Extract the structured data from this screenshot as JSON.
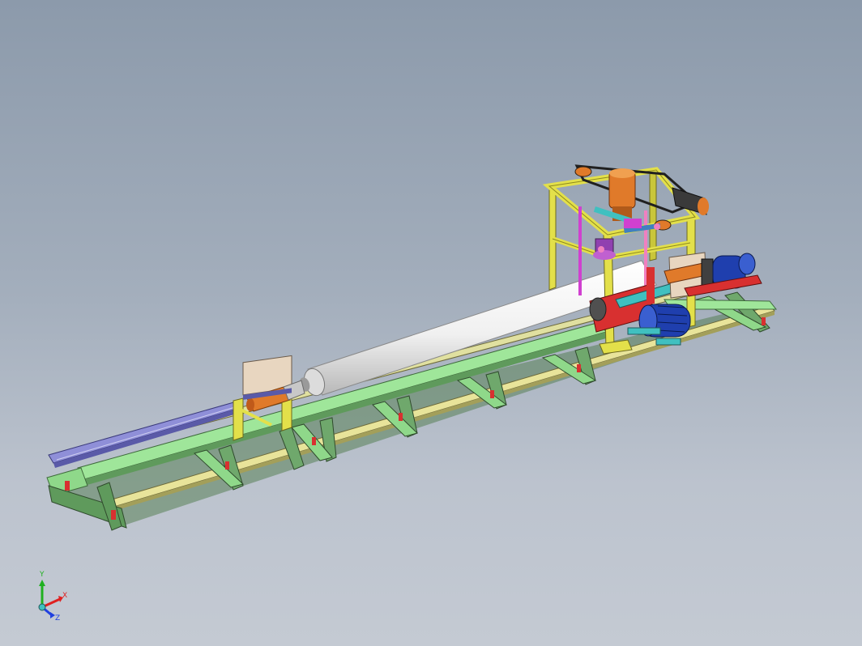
{
  "viewport": {
    "background_top": "#8c9aab",
    "background_bottom": "#c4cad3"
  },
  "model": {
    "colors": {
      "frame_green": "#9fe69a",
      "frame_green_dark": "#5f9a5c",
      "rail_yellow": "#e8e49a",
      "rail_blue": "#8f8fd8",
      "tower_yellow": "#e3e04a",
      "tower_yellow_dark": "#8e8a1e",
      "pipe_white": "#f2f2f2",
      "motor_blue": "#1f3fae",
      "motor_orange": "#e07a2a",
      "accent_magenta": "#d040d0",
      "accent_cyan": "#40c0c0",
      "accent_red": "#d83030"
    },
    "icons": [
      "coordinate-triad-icon"
    ]
  },
  "triad": {
    "x_label": "X",
    "y_label": "Y",
    "z_label": "Z",
    "x_color": "#e02020",
    "y_color": "#20b020",
    "z_color": "#2040e0"
  }
}
